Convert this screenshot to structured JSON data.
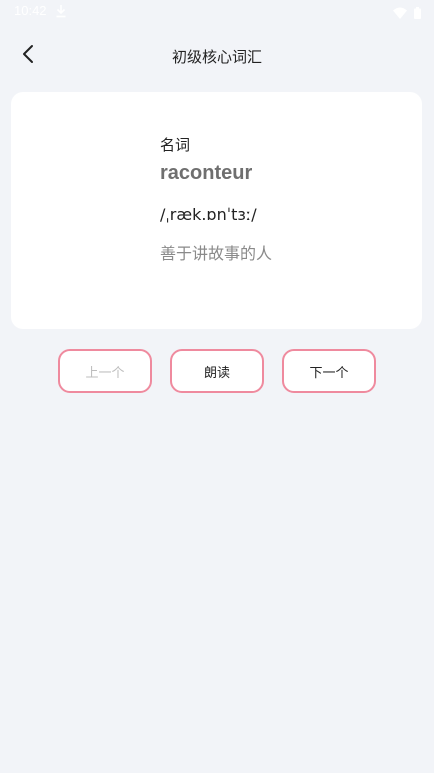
{
  "status_bar": {
    "time": "10:42",
    "icons": [
      "download-icon",
      "wifi-icon",
      "battery-icon"
    ]
  },
  "header": {
    "title": "初级核心词汇",
    "back_icon": "chevron-left-icon"
  },
  "word_card": {
    "part_of_speech": "名词",
    "word": "raconteur",
    "phonetic": "/ˌræk.ɒnˈtɜː/",
    "meaning": "善于讲故事的人"
  },
  "actions": {
    "prev_label": "上一个",
    "read_label": "朗读",
    "next_label": "下一个",
    "border_color": "#ef8a9e"
  }
}
